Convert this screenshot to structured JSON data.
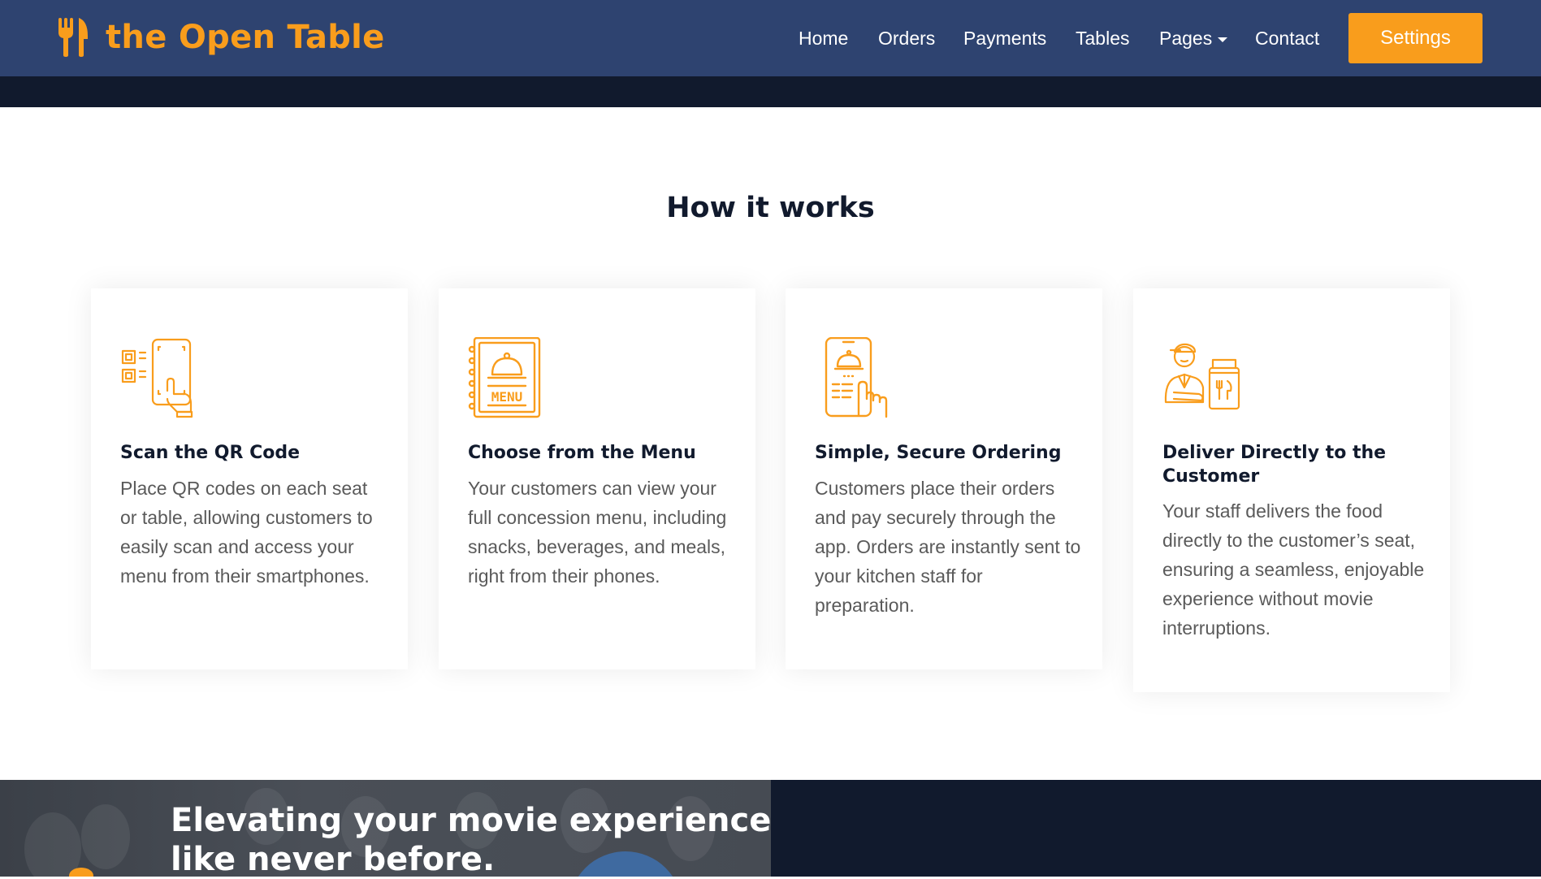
{
  "brand": {
    "name": "the Open Table",
    "icon": "fork-knife-icon"
  },
  "nav": {
    "home": "Home",
    "orders": "Orders",
    "payments": "Payments",
    "tables": "Tables",
    "pages": "Pages",
    "contact": "Contact",
    "settings": "Settings"
  },
  "colors": {
    "navbar": "#2e4370",
    "accent": "#f99d1c",
    "dark": "#111a2d"
  },
  "how_it_works": {
    "title": "How it works",
    "cards": [
      {
        "icon": "phone-qr-scan-icon",
        "title": "Scan the QR Code",
        "text": "Place QR codes on each seat or table, allowing customers to easily scan and access your menu from their smartphones."
      },
      {
        "icon": "menu-book-icon",
        "title": "Choose from the Menu",
        "text": "Your customers can view your full concession menu, including snacks, beverages, and meals, right from their phones."
      },
      {
        "icon": "phone-tap-order-icon",
        "title": "Simple, Secure Ordering",
        "text": "Customers place their orders and pay securely through the app. Orders are instantly sent to your kitchen staff for preparation."
      },
      {
        "icon": "delivery-person-icon",
        "title": "Deliver Directly to the Customer",
        "text": "Your staff delivers the food directly to the customer’s seat, ensuring a seamless, enjoyable experience without movie interruptions."
      }
    ]
  },
  "banner": {
    "heading": "Elevating your movie experience like never before."
  }
}
